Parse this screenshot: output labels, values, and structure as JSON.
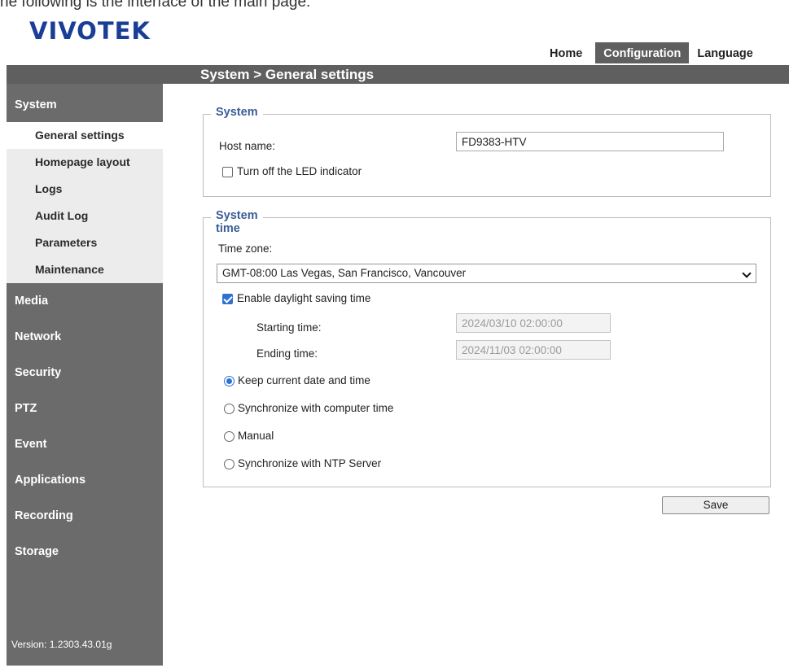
{
  "caption": "he following is the interface of the main page:",
  "logo": "VIVOTEK",
  "topnav": {
    "home": "Home",
    "configuration": "Configuration",
    "language": "Language"
  },
  "page_title": "System  > General settings",
  "sidebar": {
    "system": "System",
    "system_items": [
      "General settings",
      "Homepage layout",
      "Logs",
      "Audit Log",
      "Parameters",
      "Maintenance"
    ],
    "categories": [
      "Media",
      "Network",
      "Security",
      "PTZ",
      "Event",
      "Applications",
      "Recording",
      "Storage"
    ],
    "version": "Version: 1.2303.43.01g"
  },
  "system_section": {
    "legend": "System",
    "host_name_label": "Host name:",
    "host_name_value": "FD9383-HTV",
    "led_label": "Turn off the LED indicator",
    "led_checked": false
  },
  "time_section": {
    "legend": "System time",
    "time_zone_label": "Time zone:",
    "time_zone_value": "GMT-08:00 Las Vegas, San Francisco, Vancouver",
    "dst_label": "Enable daylight saving time",
    "dst_checked": true,
    "starting_label": "Starting time:",
    "starting_value": "2024/03/10 02:00:00",
    "ending_label": "Ending time:",
    "ending_value": "2024/11/03 02:00:00",
    "options": [
      "Keep current date and time",
      "Synchronize with computer time",
      "Manual",
      "Synchronize with NTP Server"
    ],
    "selected_option": 0
  },
  "save_label": "Save",
  "colors": {
    "logo": "#1a3e96",
    "bar": "#5f5f5f",
    "sidebar": "#6b6b6b",
    "legend": "#3a5d96",
    "accent": "#2f71d3"
  }
}
